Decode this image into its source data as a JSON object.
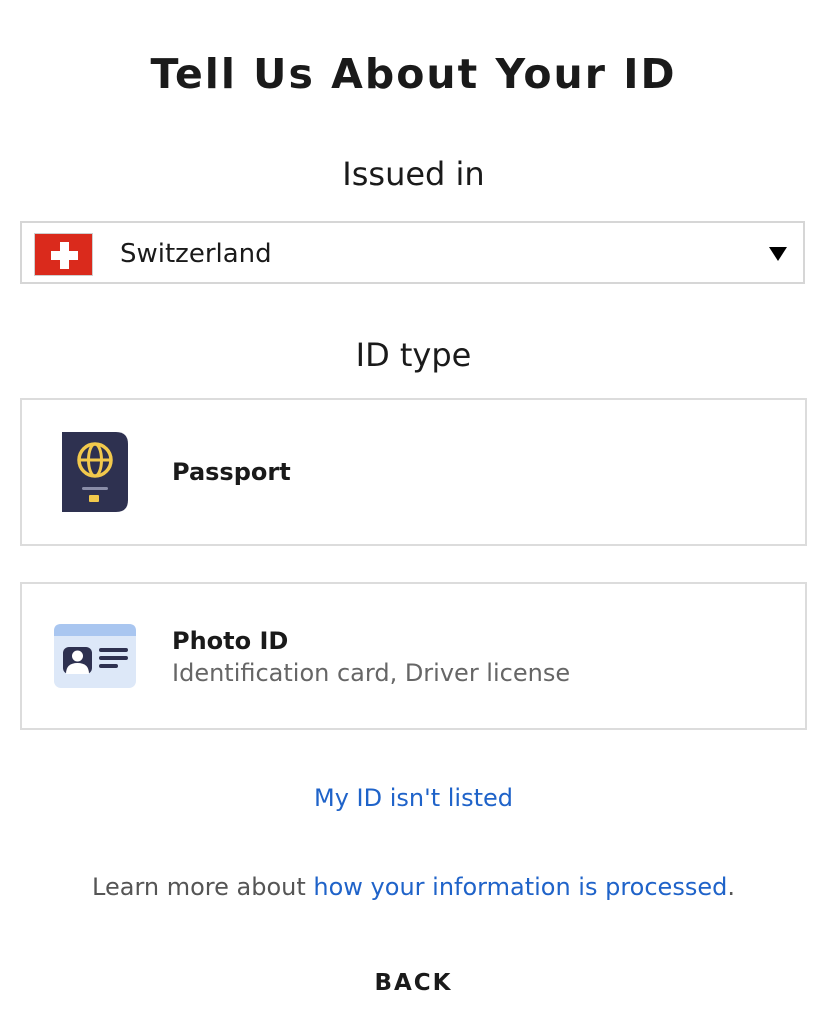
{
  "page": {
    "title": "Tell Us About Your ID"
  },
  "issued_in": {
    "label": "Issued in",
    "country_flag_icon": "swiss-flag-icon",
    "selected_country": "Switzerland",
    "dropdown_icon": "caret-down-icon"
  },
  "id_type": {
    "label": "ID type",
    "options": [
      {
        "icon": "passport-icon",
        "title": "Passport",
        "subtitle": ""
      },
      {
        "icon": "photo-id-card-icon",
        "title": "Photo ID",
        "subtitle": "Identification card, Driver license"
      }
    ]
  },
  "links": {
    "not_listed": "My ID isn't listed",
    "learn_more_prefix": "Learn more about ",
    "learn_more_link": "how your information is processed",
    "learn_more_suffix": "."
  },
  "footer": {
    "back_label": "BACK"
  },
  "colors": {
    "link": "#1f63c9",
    "flag_red": "#da2a1c",
    "passport_navy": "#2e3150",
    "passport_gold": "#f2c94c",
    "card_blue": "#dde8f8"
  }
}
